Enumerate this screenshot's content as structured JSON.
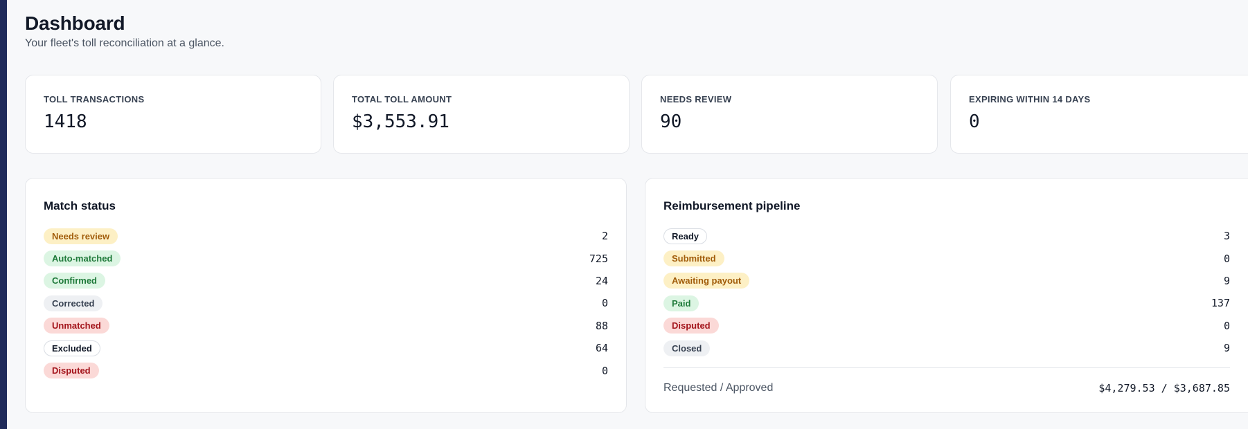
{
  "header": {
    "title": "Dashboard",
    "subtitle": "Your fleet's toll reconciliation at a glance."
  },
  "kpis": [
    {
      "label": "TOLL TRANSACTIONS",
      "value": "1418"
    },
    {
      "label": "TOTAL TOLL AMOUNT",
      "value": "$3,553.91"
    },
    {
      "label": "NEEDS REVIEW",
      "value": "90"
    },
    {
      "label": "EXPIRING WITHIN 14 DAYS",
      "value": "0"
    }
  ],
  "match_status": {
    "title": "Match status",
    "items": [
      {
        "label": "Needs review",
        "count": "2",
        "tone": "warn"
      },
      {
        "label": "Auto-matched",
        "count": "725",
        "tone": "ok"
      },
      {
        "label": "Confirmed",
        "count": "24",
        "tone": "ok"
      },
      {
        "label": "Corrected",
        "count": "0",
        "tone": "neutral"
      },
      {
        "label": "Unmatched",
        "count": "88",
        "tone": "danger"
      },
      {
        "label": "Excluded",
        "count": "64",
        "tone": "outline"
      },
      {
        "label": "Disputed",
        "count": "0",
        "tone": "danger"
      }
    ]
  },
  "reimbursement": {
    "title": "Reimbursement pipeline",
    "items": [
      {
        "label": "Ready",
        "count": "3",
        "tone": "outline"
      },
      {
        "label": "Submitted",
        "count": "0",
        "tone": "warn"
      },
      {
        "label": "Awaiting payout",
        "count": "9",
        "tone": "warn"
      },
      {
        "label": "Paid",
        "count": "137",
        "tone": "ok"
      },
      {
        "label": "Disputed",
        "count": "0",
        "tone": "danger"
      },
      {
        "label": "Closed",
        "count": "9",
        "tone": "neutral"
      }
    ],
    "summary_label": "Requested / Approved",
    "summary_value": "$4,279.53 / $3,687.85"
  },
  "colors": {
    "sidebar_accent": "#1f2a5a",
    "warn_bg": "#fdf0c5",
    "ok_bg": "#dcf5e3",
    "danger_bg": "#fbd9d7",
    "neutral_bg": "#eef0f3"
  }
}
